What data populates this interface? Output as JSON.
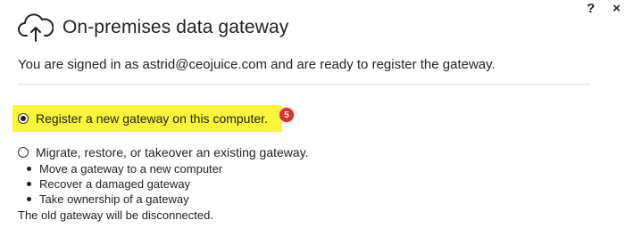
{
  "window": {
    "help_label": "?",
    "close_label": "×"
  },
  "header": {
    "icon": "cloud-upload-icon",
    "title": "On-premises data gateway"
  },
  "status": {
    "signed_in_text": "You are signed in as astrid@ceojuice.com and are ready to register the gateway."
  },
  "options": [
    {
      "label": "Register a new gateway on this computer.",
      "selected": true,
      "highlight_color": "#fbf53a"
    },
    {
      "label": "Migrate, restore, or takeover an existing gateway.",
      "selected": false,
      "sub_items": [
        "Move a gateway to a new computer",
        "Recover a damaged gateway",
        "Take ownership of a gateway"
      ],
      "note": "The old gateway will be disconnected."
    }
  ],
  "step_badge": {
    "number": "5",
    "color": "#d9322b"
  }
}
